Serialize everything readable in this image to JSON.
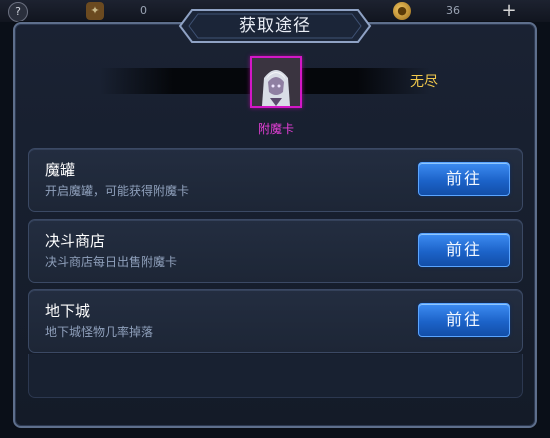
{
  "hud": {
    "help_icon": "?",
    "left_count": "0",
    "right_count": "36",
    "icons": [
      "help-icon",
      "character-icon",
      "coin-icon",
      "plus-icon"
    ]
  },
  "dialog": {
    "title": "获取途径",
    "accent_color": "#d317c7",
    "button_color": "#1c63c9"
  },
  "item": {
    "name": "附魔卡",
    "quantity": "无尽",
    "icon": "enchant-card-portrait"
  },
  "sources": [
    {
      "title": "魔罐",
      "description": "开启魔罐，可能获得附魔卡",
      "button": "前往"
    },
    {
      "title": "决斗商店",
      "description": "决斗商店每日出售附魔卡",
      "button": "前往"
    },
    {
      "title": "地下城",
      "description": "地下城怪物几率掉落",
      "button": "前往"
    }
  ]
}
